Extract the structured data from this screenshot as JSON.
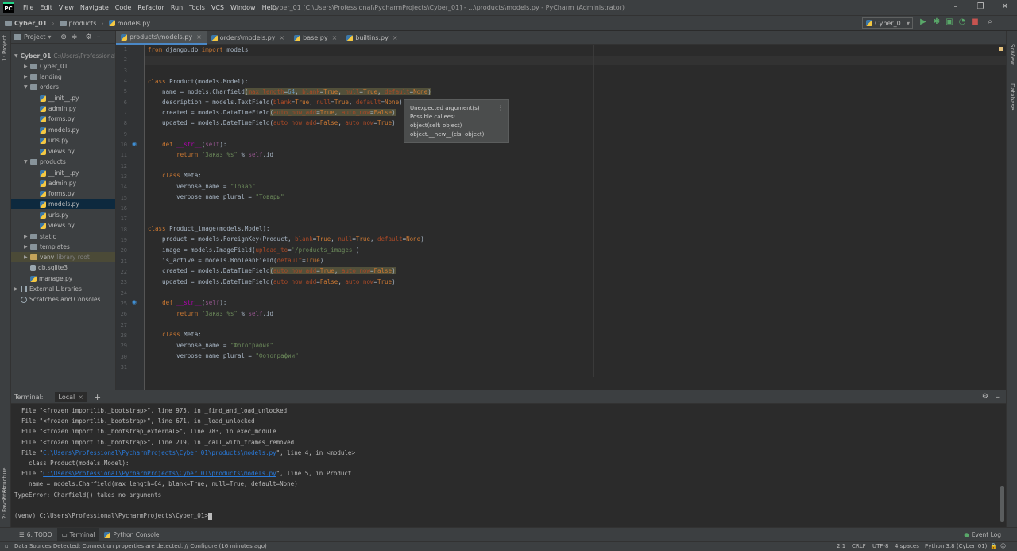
{
  "title_bar": {
    "logo": "PC",
    "menu": [
      "File",
      "Edit",
      "View",
      "Navigate",
      "Code",
      "Refactor",
      "Run",
      "Tools",
      "VCS",
      "Window",
      "Help"
    ],
    "window_title": "Cyber_01 [C:\\Users\\Professional\\PycharmProjects\\Cyber_01] - ...\\products\\models.py - PyCharm (Administrator)"
  },
  "navbar": {
    "breadcrumbs": [
      "Cyber_01",
      "products",
      "models.py"
    ],
    "run_config": "Cyber_01"
  },
  "left_stripe": {
    "project": "1: Project",
    "structure": "2: Structure",
    "favorites": "2: Favorites"
  },
  "right_stripe": {
    "sciview": "SciView",
    "database": "Database"
  },
  "project_panel": {
    "header_label": "Project",
    "tree": [
      {
        "label": "Cyber_01",
        "extra": "C:\\Users\\Professional",
        "kind": "root"
      },
      {
        "label": "Cyber_01",
        "kind": "folder"
      },
      {
        "label": "landing",
        "kind": "folder"
      },
      {
        "label": "orders",
        "kind": "folder-open"
      },
      {
        "label": "__init__.py",
        "kind": "py"
      },
      {
        "label": "admin.py",
        "kind": "py"
      },
      {
        "label": "forms.py",
        "kind": "py"
      },
      {
        "label": "models.py",
        "kind": "py"
      },
      {
        "label": "urls.py",
        "kind": "py"
      },
      {
        "label": "views.py",
        "kind": "py"
      },
      {
        "label": "products",
        "kind": "folder-open"
      },
      {
        "label": "__init__.py",
        "kind": "py"
      },
      {
        "label": "admin.py",
        "kind": "py"
      },
      {
        "label": "forms.py",
        "kind": "py"
      },
      {
        "label": "models.py",
        "kind": "py",
        "selected": true
      },
      {
        "label": "urls.py",
        "kind": "py"
      },
      {
        "label": "views.py",
        "kind": "py"
      },
      {
        "label": "static",
        "kind": "folder"
      },
      {
        "label": "templates",
        "kind": "folder"
      },
      {
        "label": "venv",
        "extra": "library root",
        "kind": "folder"
      },
      {
        "label": "db.sqlite3",
        "kind": "db"
      },
      {
        "label": "manage.py",
        "kind": "py"
      },
      {
        "label": "External Libraries",
        "kind": "lib"
      },
      {
        "label": "Scratches and Consoles",
        "kind": "scratch"
      }
    ]
  },
  "editor_tabs": [
    {
      "label": "products\\models.py",
      "active": true
    },
    {
      "label": "orders\\models.py",
      "active": false
    },
    {
      "label": "base.py",
      "active": false
    },
    {
      "label": "builtins.py",
      "active": false
    }
  ],
  "editor": {
    "line_numbers": [
      "1",
      "2",
      "3",
      "4",
      "5",
      "6",
      "7",
      "8",
      "9",
      "10",
      "11",
      "12",
      "13",
      "14",
      "15",
      "16",
      "17",
      "18",
      "19",
      "20",
      "21",
      "22",
      "23",
      "24",
      "25",
      "26",
      "27",
      "28",
      "29",
      "30",
      "31"
    ]
  },
  "tooltip": {
    "line1": "Unexpected argument(s)",
    "line2": "Possible callees:",
    "line3": "object(self: object)",
    "line4": "object.__new__(cls: object)"
  },
  "terminal": {
    "title": "Terminal:",
    "tab": "Local",
    "lines": [
      {
        "pre": "  File \"<frozen importlib._bootstrap>\", line 975, in _find_and_load_unlocked",
        "link": "",
        "post": ""
      },
      {
        "pre": "  File \"<frozen importlib._bootstrap>\", line 671, in _load_unlocked",
        "link": "",
        "post": ""
      },
      {
        "pre": "  File \"<frozen importlib._bootstrap_external>\", line 783, in exec_module",
        "link": "",
        "post": ""
      },
      {
        "pre": "  File \"<frozen importlib._bootstrap>\", line 219, in _call_with_frames_removed",
        "link": "",
        "post": ""
      },
      {
        "pre": "  File \"",
        "link": "C:\\Users\\Professional\\PycharmProjects\\Cyber_01\\products\\models.py",
        "post": "\", line 4, in <module>"
      },
      {
        "pre": "    class Product(models.Model):",
        "link": "",
        "post": ""
      },
      {
        "pre": "  File \"",
        "link": "C:\\Users\\Professional\\PycharmProjects\\Cyber_01\\products\\models.py",
        "post": "\", line 5, in Product"
      },
      {
        "pre": "    name = models.Charfield(max_length=64, blank=True, null=True, default=None)",
        "link": "",
        "post": ""
      },
      {
        "pre": "TypeError: Charfield() takes no arguments",
        "link": "",
        "post": ""
      },
      {
        "pre": "",
        "link": "",
        "post": ""
      },
      {
        "pre": "(venv) C:\\Users\\Professional\\PycharmProjects\\Cyber_01>",
        "link": "",
        "post": ""
      }
    ]
  },
  "bottom_tools": {
    "todo": "6: TODO",
    "terminal": "Terminal",
    "python_console": "Python Console",
    "event_log": "Event Log"
  },
  "status_bar": {
    "message": "Data Sources Detected: Connection properties are detected. // Configure (16 minutes ago)",
    "position": "2:1",
    "line_sep": "CRLF",
    "encoding": "UTF-8",
    "indent": "4 spaces",
    "interpreter": "Python 3.8 (Cyber_01)"
  }
}
